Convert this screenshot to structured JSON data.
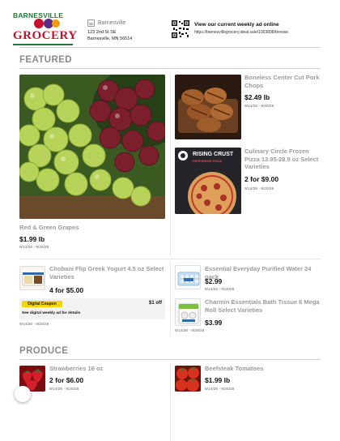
{
  "header": {
    "logo_top": "BARNESVILLE",
    "logo_bottom": "GROCERY",
    "store_name": "Barnesville",
    "address_line1": "123 2nd St SE",
    "address_line2": "Barnesville, MN 56514",
    "weekly_ad_title": "View our current weekly ad online",
    "weekly_ad_url": "https://barnesvillegrocery.ideal.sale/1003898/browse"
  },
  "sections": {
    "featured": "FEATURED",
    "produce": "PRODUCE"
  },
  "featured": {
    "hero": {
      "name": "Red & Green Grapes",
      "price": "$1.99 lb",
      "dates": "9/14/26 - 9/20/26"
    },
    "pork": {
      "name": "Boneless Center Cut Pork Chops",
      "price": "$2.49 lb",
      "dates": "9/14/26 - 9/20/26"
    },
    "pizza": {
      "name": "Culinary Circle Frozen Pizza 13.95-28.9 oz Select Varieties",
      "price": "2 for $9.00",
      "dates": "9/14/26 - 9/20/26",
      "box_brand": "RISING CRUST",
      "box_variety": "PEPPERONI PIZZA"
    },
    "yogurt": {
      "name": "Chobani Flip Greek Yogurt 4.5 oz Select Varieties",
      "price": "4 for $5.00",
      "dates": "9/14/26 - 9/20/26",
      "coupon": {
        "badge": "Digital Coupon",
        "amount": "$1 off",
        "note": "See digital weekly ad for details"
      }
    },
    "water": {
      "name": "Essential Everyday Purified Water 24 pack",
      "price": "$2.99",
      "dates": "9/14/26 - 9/20/26"
    },
    "tissue": {
      "name": "Charmin Essentials Bath Tissue 6 Mega Roll Select Varieties",
      "price": "$3.99",
      "dates": "9/14/26 - 9/20/26"
    }
  },
  "produce": {
    "strawberries": {
      "name": "Strawberries 16 oz",
      "price": "2 for $6.00",
      "dates": "9/14/26 - 9/20/26"
    },
    "tomatoes": {
      "name": "Beefsteak Tomatoes",
      "price": "$1.99 lb",
      "dates": "9/14/26 - 9/20/26"
    }
  }
}
